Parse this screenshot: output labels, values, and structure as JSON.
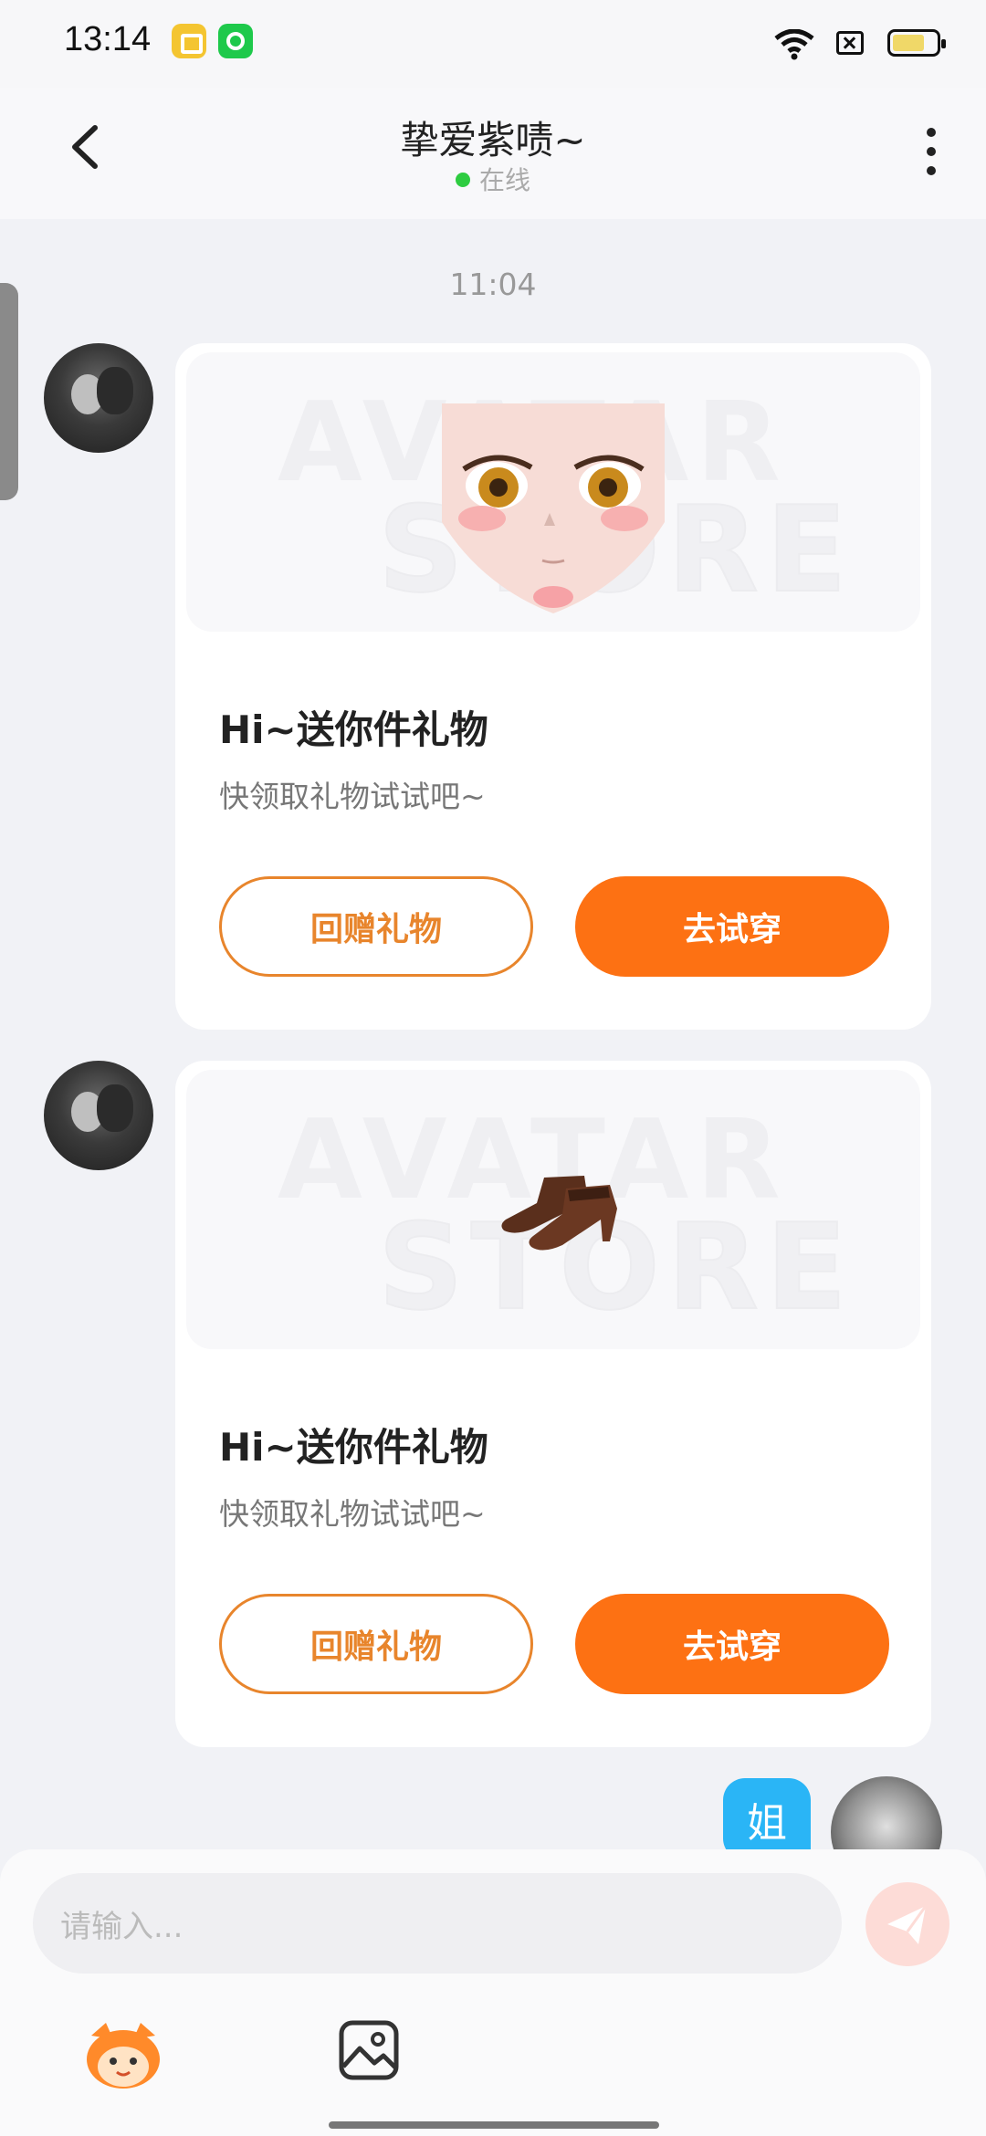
{
  "status_bar": {
    "time": "13:14"
  },
  "header": {
    "title": "挚爱紫啧~",
    "status": "在线"
  },
  "chat": {
    "timestamp": "11:04",
    "messages": [
      {
        "title": "Hi~送你件礼物",
        "subtitle": "快领取礼物试试吧~",
        "return_gift_label": "回赠礼物",
        "try_on_label": "去试穿",
        "watermark_1": "AVATAR",
        "watermark_2": "STORE"
      },
      {
        "title": "Hi~送你件礼物",
        "subtitle": "快领取礼物试试吧~",
        "return_gift_label": "回赠礼物",
        "try_on_label": "去试穿",
        "watermark_1": "AVATAR",
        "watermark_2": "STORE"
      }
    ],
    "outgoing": {
      "text": "姐"
    }
  },
  "input": {
    "placeholder": "请输入..."
  },
  "colors": {
    "accent": "#fd7113",
    "bubble": "#2ab5f6",
    "online": "#2ecc40"
  }
}
